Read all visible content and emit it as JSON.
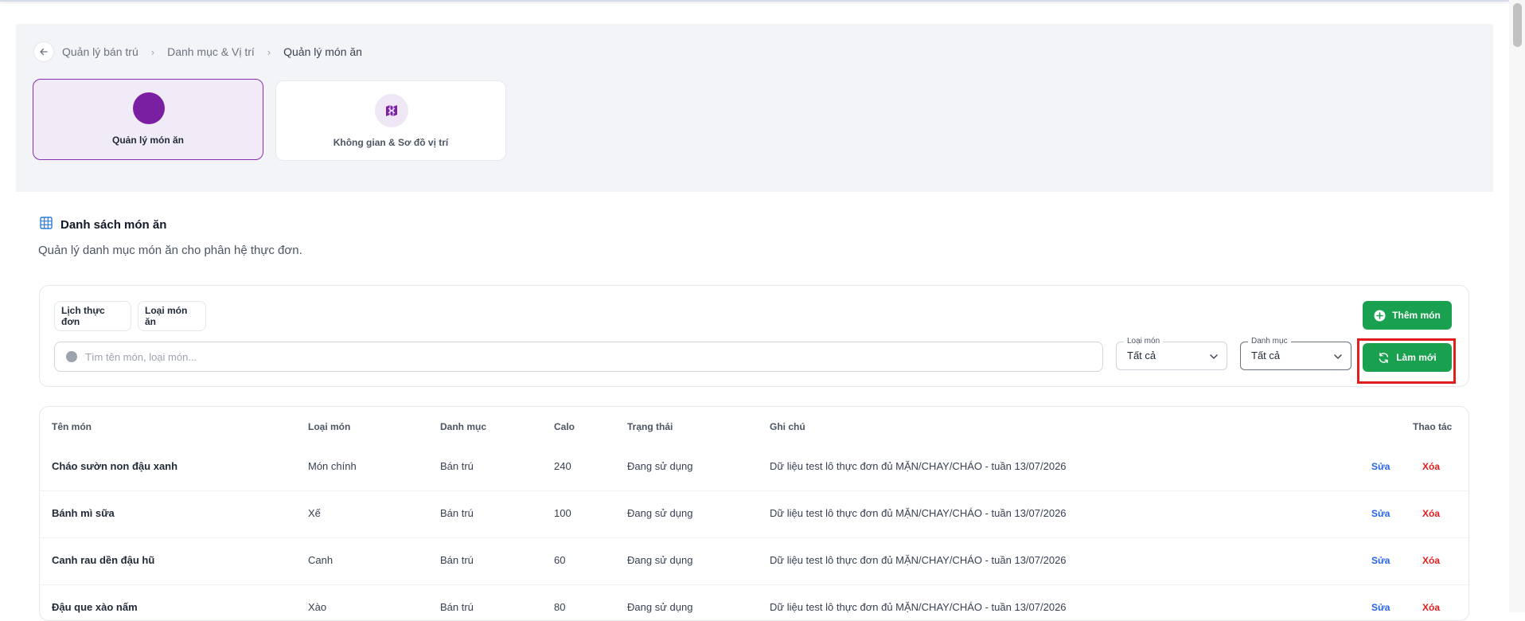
{
  "breadcrumb": {
    "items": [
      "Quản lý bán trú",
      "Danh mục & Vị trí",
      "Quản lý món ăn"
    ]
  },
  "modules": [
    {
      "label": "Quản lý món ăn",
      "active": true
    },
    {
      "label": "Không gian & Sơ đồ vị trí",
      "active": false
    }
  ],
  "section": {
    "title": "Danh sách món ăn",
    "subtitle": "Quản lý danh mục món ăn cho phân hệ thực đơn."
  },
  "toolbar": {
    "menu_schedule": "Lịch thực đơn",
    "dish_type": "Loại món ăn",
    "add_label": "Thêm món",
    "refresh_label": "Làm mới",
    "search_placeholder": "Tìm tên món, loại món...",
    "filter_type": {
      "legend": "Loại món",
      "value": "Tất cả"
    },
    "filter_category": {
      "legend": "Danh mục",
      "value": "Tất cả"
    }
  },
  "table": {
    "headers": {
      "name": "Tên món",
      "type": "Loại món",
      "category": "Danh mục",
      "calo": "Calo",
      "status": "Trạng thái",
      "note": "Ghi chú",
      "actions": "Thao tác"
    },
    "edit_label": "Sửa",
    "delete_label": "Xóa",
    "rows": [
      {
        "name": "Cháo sườn non đậu xanh",
        "type": "Món chính",
        "category": "Bán trú",
        "calo": "240",
        "status": "Đang sử dụng",
        "note": "Dữ liệu test lô thực đơn đủ MẶN/CHAY/CHÁO - tuần 13/07/2026"
      },
      {
        "name": "Bánh mì sữa",
        "type": "Xế",
        "category": "Bán trú",
        "calo": "100",
        "status": "Đang sử dụng",
        "note": "Dữ liệu test lô thực đơn đủ MẶN/CHAY/CHÁO - tuần 13/07/2026"
      },
      {
        "name": "Canh rau dền đậu hũ",
        "type": "Canh",
        "category": "Bán trú",
        "calo": "60",
        "status": "Đang sử dụng",
        "note": "Dữ liệu test lô thực đơn đủ MẶN/CHAY/CHÁO - tuần 13/07/2026"
      },
      {
        "name": "Đậu que xào nấm",
        "type": "Xào",
        "category": "Bán trú",
        "calo": "80",
        "status": "Đang sử dụng",
        "note": "Dữ liệu test lô thực đơn đủ MẶN/CHAY/CHÁO - tuần 13/07/2026"
      }
    ]
  }
}
